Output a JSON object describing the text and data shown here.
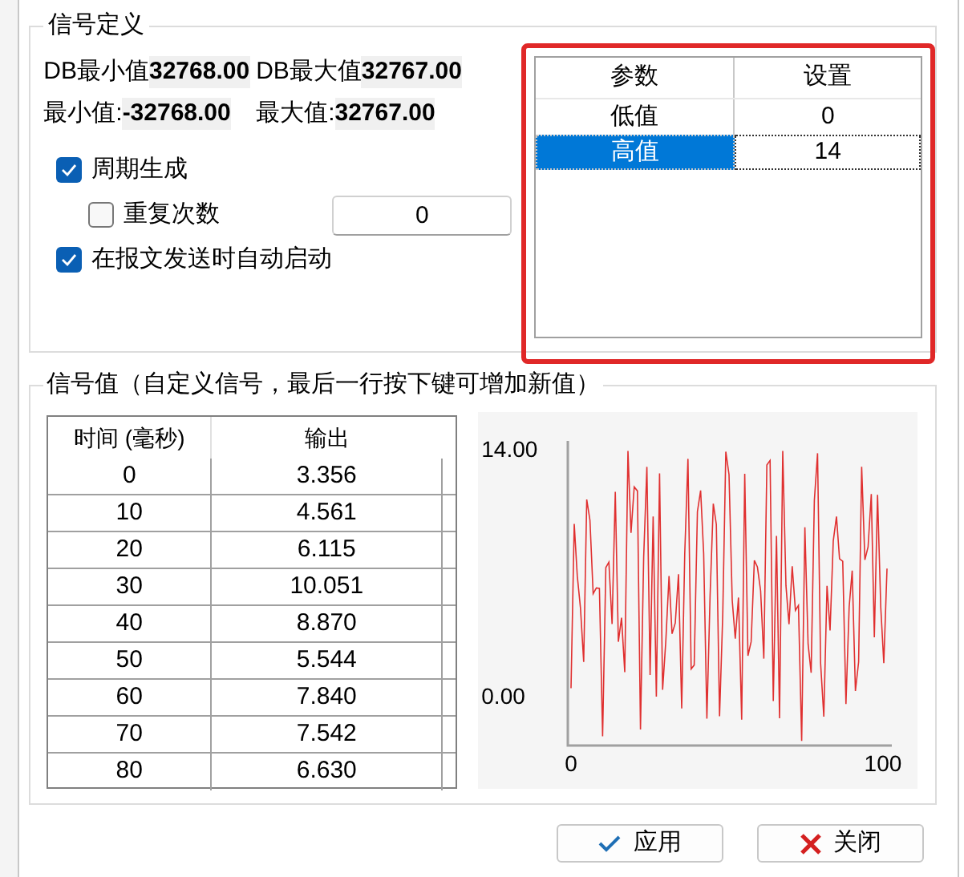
{
  "definition_group": {
    "title": "信号定义",
    "ranges": [
      {
        "label": "DB最小值",
        "value": "32768.00"
      },
      {
        "label": "DB最大值",
        "value": "32767.00"
      },
      {
        "label": "最小值:",
        "value": "-32768.00"
      },
      {
        "label": "最大值:",
        "value": "32767.00"
      }
    ],
    "options": [
      {
        "label": "周期生成",
        "checked": true,
        "indented": false
      },
      {
        "label": "重复次数",
        "checked": false,
        "indented": true,
        "value": "0"
      },
      {
        "label": "在报文发送时自动启动",
        "checked": true,
        "indented": false
      }
    ],
    "param_table": {
      "columns": [
        "参数",
        "设置"
      ],
      "rows": [
        {
          "cells": [
            "低值",
            "0"
          ],
          "selected": false
        },
        {
          "cells": [
            "高值",
            "14"
          ],
          "selected": true
        }
      ]
    },
    "highlighted": true
  },
  "values_group": {
    "title": "信号值（自定义信号，最后一行按下键可增加新值）",
    "table": {
      "columns": [
        "时间 (毫秒)",
        "输出"
      ],
      "rows": [
        [
          "0",
          "3.356"
        ],
        [
          "10",
          "4.561"
        ],
        [
          "20",
          "6.115"
        ],
        [
          "30",
          "10.051"
        ],
        [
          "40",
          "8.870"
        ],
        [
          "50",
          "5.544"
        ],
        [
          "60",
          "7.840"
        ],
        [
          "70",
          "7.542"
        ],
        [
          "80",
          "6.630"
        ]
      ]
    },
    "plot": {
      "y_top_label": "14.00",
      "y_bottom_label": "0.00",
      "x_left_label": "0",
      "x_right_label": "100"
    }
  },
  "buttons": [
    {
      "label": "应用",
      "kind": "apply"
    },
    {
      "label": "关闭",
      "kind": "close"
    }
  ]
}
